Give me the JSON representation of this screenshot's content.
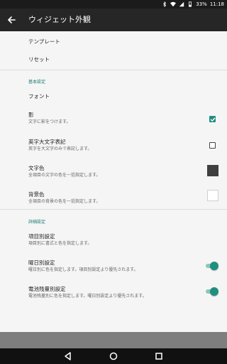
{
  "status_bar": {
    "battery": "33%",
    "time": "11:18",
    "icons": [
      "bluetooth-icon",
      "wifi-icon",
      "signal-icon",
      "battery-icon"
    ]
  },
  "app_bar": {
    "back_icon": "arrow-left-icon",
    "title": "ウィジェット外観"
  },
  "items_top": {
    "template": "テンプレート",
    "reset": "リセット"
  },
  "basic": {
    "header": "基本設定",
    "font": "フォント",
    "shadow": {
      "title": "影",
      "subtitle": "文字に影をつけます。",
      "checked": true
    },
    "uppercase": {
      "title": "英字大文字表記",
      "subtitle": "英字を大文字のみで表記します。",
      "checked": false
    },
    "text_color": {
      "title": "文字色",
      "subtitle": "全項目の文字の色を一括指定します。",
      "color": "#3f3f3f"
    },
    "bg_color": {
      "title": "背景色",
      "subtitle": "全項目の背景の色を一括指定します。",
      "color": "#ffffff"
    }
  },
  "detail": {
    "header": "詳細設定",
    "per_item": {
      "title": "項目別設定",
      "subtitle": "項目別に書式と色を指定します。"
    },
    "weekday": {
      "title": "曜日別設定",
      "subtitle": "曜日別に色を指定します。項目別設定より優先されます。",
      "on": true
    },
    "battery": {
      "title": "電池残量別設定",
      "subtitle": "電池残量別に色を指定します。曜日別設定より優先されます。",
      "on": true
    }
  },
  "colors": {
    "accent": "#1f8f80",
    "section_text": "#1e7d73",
    "app_bar": "#262626"
  },
  "nav_bar": {
    "icons": [
      "back-triangle-icon",
      "home-circle-icon",
      "recents-square-icon"
    ]
  }
}
